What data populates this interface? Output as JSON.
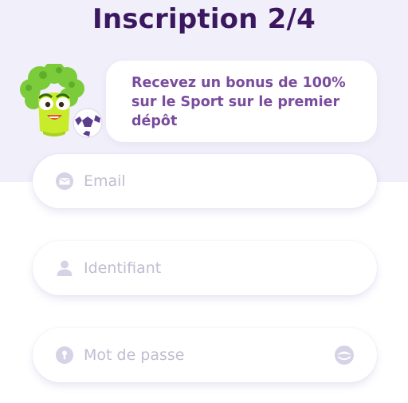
{
  "title": "Inscription 2/4",
  "promo": {
    "text": "Recevez un bonus de 100% sur le Sport sur le premier dépôt"
  },
  "form": {
    "email": {
      "placeholder": "Email",
      "value": "",
      "icon": "envelope-icon"
    },
    "username": {
      "placeholder": "Identifiant",
      "value": "",
      "icon": "user-icon"
    },
    "password": {
      "placeholder": "Mot de passe",
      "value": "",
      "icon": "info-icon",
      "toggle_icon": "eye-toggle-icon"
    }
  },
  "colors": {
    "title": "#3b1760",
    "promo_text": "#7a4c9d",
    "top_background": "#f1effa",
    "icon": "#d7d3e6",
    "mascot_green": "#7ccb3a",
    "mascot_face": "#c8ec2a"
  }
}
